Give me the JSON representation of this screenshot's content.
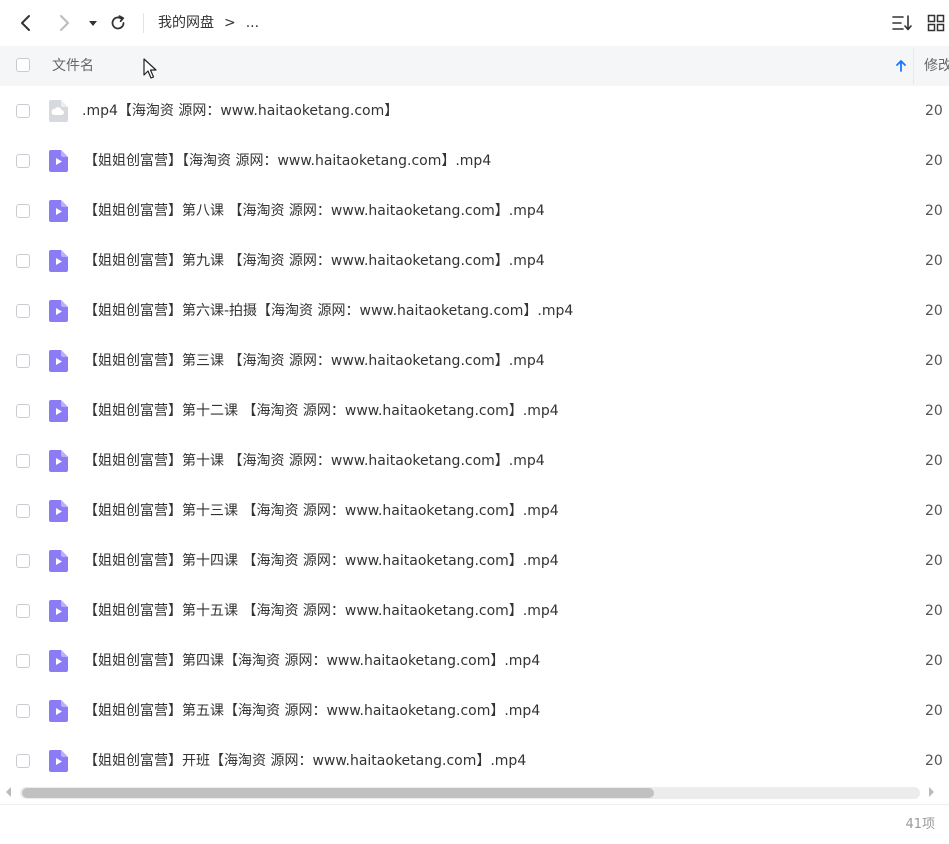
{
  "toolbar": {
    "back_icon": "chevron-left-icon",
    "forward_icon": "chevron-right-icon",
    "dropdown_icon": "caret-down-icon",
    "refresh_icon": "refresh-icon",
    "breadcrumb": {
      "root": "我的网盘",
      "separator": ">",
      "more": "..."
    },
    "sort_icon": "sort-icon",
    "grid_icon": "grid-view-icon"
  },
  "table": {
    "headers": {
      "name": "文件名",
      "modified": "修改"
    },
    "rows": [
      {
        "name": ".mp4【海淘资 源网：www.haitaoketang.com】",
        "date": "20",
        "type": "generic"
      },
      {
        "name": "【姐姐创富营】【海淘资 源网：www.haitaoketang.com】.mp4",
        "date": "20",
        "type": "video"
      },
      {
        "name": "【姐姐创富营】第八课 【海淘资 源网：www.haitaoketang.com】.mp4",
        "date": "20",
        "type": "video"
      },
      {
        "name": "【姐姐创富营】第九课 【海淘资 源网：www.haitaoketang.com】.mp4",
        "date": "20",
        "type": "video"
      },
      {
        "name": "【姐姐创富营】第六课-拍摄【海淘资 源网：www.haitaoketang.com】.mp4",
        "date": "20",
        "type": "video"
      },
      {
        "name": "【姐姐创富营】第三课 【海淘资 源网：www.haitaoketang.com】.mp4",
        "date": "20",
        "type": "video"
      },
      {
        "name": "【姐姐创富营】第十二课 【海淘资 源网：www.haitaoketang.com】.mp4",
        "date": "20",
        "type": "video"
      },
      {
        "name": "【姐姐创富营】第十课 【海淘资 源网：www.haitaoketang.com】.mp4",
        "date": "20",
        "type": "video"
      },
      {
        "name": "【姐姐创富营】第十三课 【海淘资 源网：www.haitaoketang.com】.mp4",
        "date": "20",
        "type": "video"
      },
      {
        "name": "【姐姐创富营】第十四课 【海淘资 源网：www.haitaoketang.com】.mp4",
        "date": "20",
        "type": "video"
      },
      {
        "name": "【姐姐创富营】第十五课 【海淘资 源网：www.haitaoketang.com】.mp4",
        "date": "20",
        "type": "video"
      },
      {
        "name": "【姐姐创富营】第四课【海淘资 源网：www.haitaoketang.com】.mp4",
        "date": "20",
        "type": "video"
      },
      {
        "name": "【姐姐创富营】第五课【海淘资 源网：www.haitaoketang.com】.mp4",
        "date": "20",
        "type": "video"
      },
      {
        "name": "【姐姐创富营】开班【海淘资 源网：www.haitaoketang.com】.mp4",
        "date": "20",
        "type": "video"
      }
    ]
  },
  "footer": {
    "item_count": "41项"
  },
  "colors": {
    "accent": "#1677ff",
    "video_icon": "#8b7cf6",
    "generic_icon": "#d6d9de"
  }
}
